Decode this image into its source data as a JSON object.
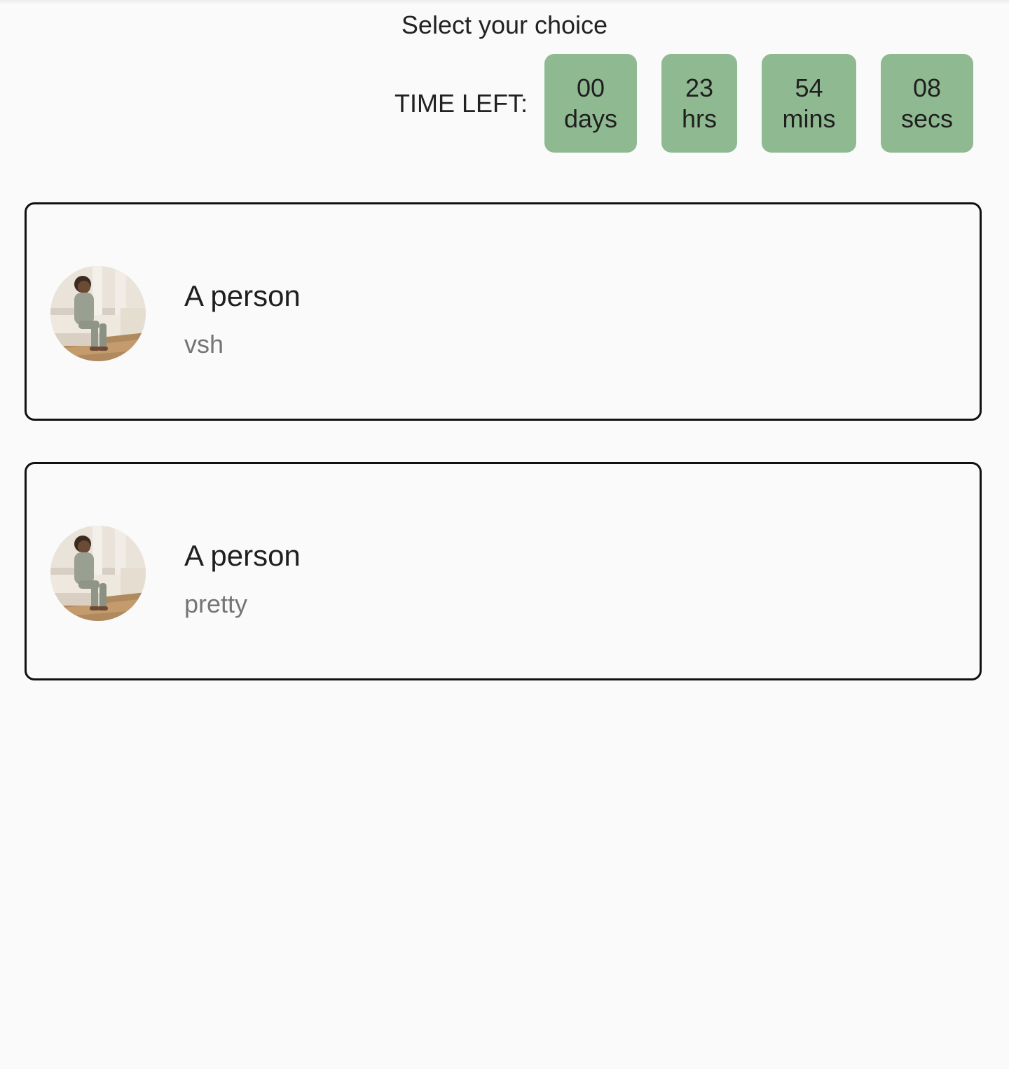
{
  "header": {
    "title": "Select your choice"
  },
  "timer": {
    "label": "TIME LEFT:",
    "days": {
      "value": "00",
      "unit": "days"
    },
    "hours": {
      "value": "23",
      "unit": "hrs"
    },
    "minutes": {
      "value": "54",
      "unit": "mins"
    },
    "seconds": {
      "value": "08",
      "unit": "secs"
    },
    "box_color": "#8fba91"
  },
  "choices": [
    {
      "title": "A person",
      "subtitle": "vsh"
    },
    {
      "title": "A person",
      "subtitle": "pretty"
    }
  ]
}
